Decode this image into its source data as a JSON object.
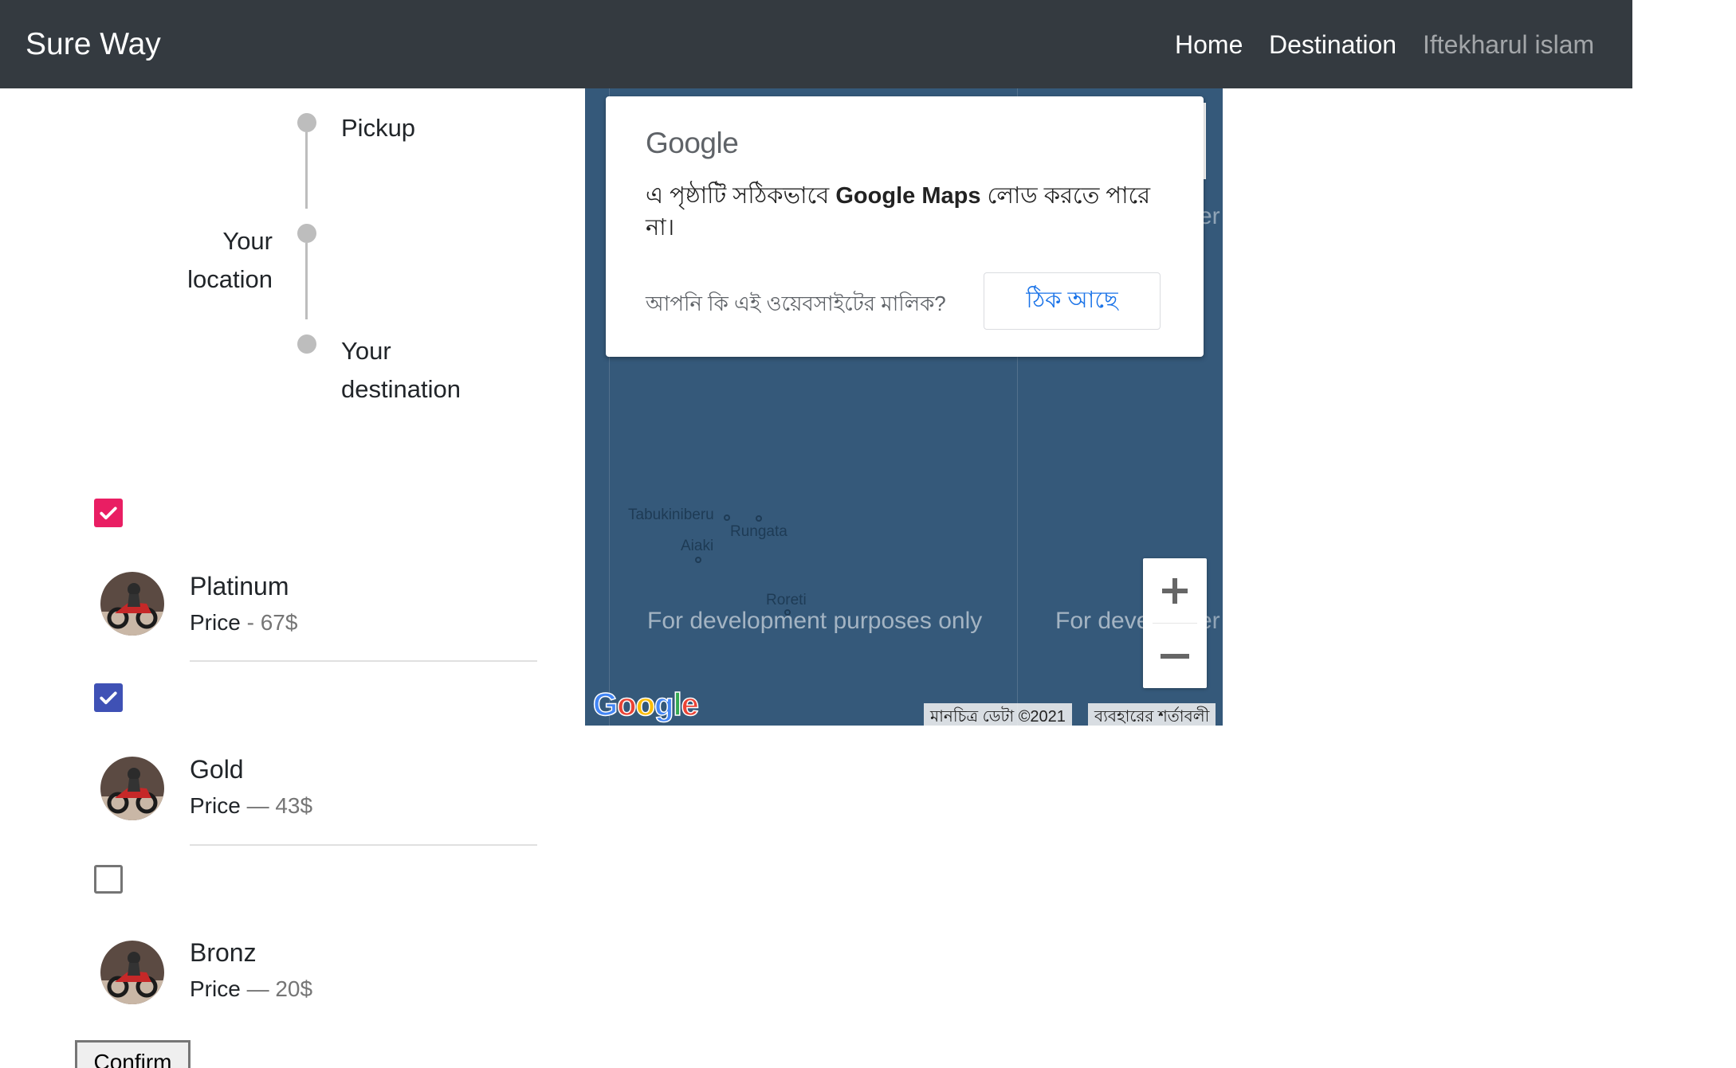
{
  "navbar": {
    "brand": "Sure Way",
    "links": [
      "Home",
      "Destination",
      "Iftekharul islam"
    ]
  },
  "timeline": {
    "pickup": "Pickup",
    "location": "Your location",
    "destination": "Your destination"
  },
  "packages": [
    {
      "name": "Platinum",
      "price_label": "Price",
      "separator": " - ",
      "price": "67$",
      "checked": true,
      "check_color": "#e91e63"
    },
    {
      "name": "Gold",
      "price_label": "Price",
      "separator": " — ",
      "price": "43$",
      "checked": true,
      "check_color": "#3f51b5"
    },
    {
      "name": "Bronz",
      "price_label": "Price",
      "separator": " — ",
      "price": "20$",
      "checked": false
    }
  ],
  "confirm_label": "Confirm",
  "map": {
    "dialog_logo": "Google",
    "dialog_message_pre": "এ পৃষ্ঠাটি সঠিকভাবে ",
    "dialog_message_bold": "Google Maps",
    "dialog_message_post": " লোড করতে পারে না।",
    "dialog_owner_question": "আপনি কি এই ওয়েবসাইটের মালিক?",
    "dialog_ok": "ঠিক আছে",
    "dev_watermark": "For development purposes only",
    "dev_watermark_partial": "For deve",
    "places": [
      "Tabukiniberu",
      "Rungata",
      "Aiaki",
      "Roreti"
    ],
    "zoom_in": "+",
    "zoom_out": "−",
    "logo": "Google",
    "attribution_data": "মানচিত্র ডেটা ©2021",
    "attribution_terms": "ব্যবহারের শর্তাবলী"
  },
  "colors": {
    "navbar_bg": "#343a40",
    "map_bg": "#35597a",
    "check_pink": "#e91e63",
    "check_indigo": "#3f51b5",
    "link_blue": "#1a73e8"
  }
}
